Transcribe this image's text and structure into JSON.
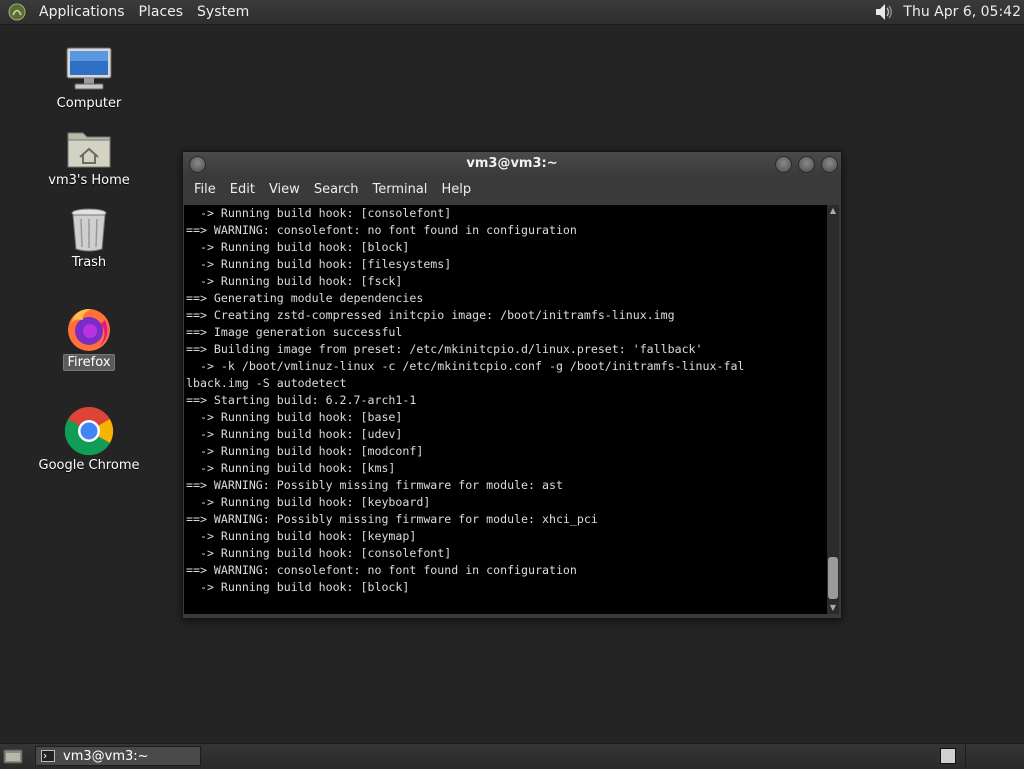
{
  "top_panel": {
    "menus": [
      "Applications",
      "Places",
      "System"
    ],
    "clock": "Thu Apr  6, 05:42",
    "icons": {
      "logo": "distro-logo-icon",
      "volume": "volume-icon"
    }
  },
  "desktop": {
    "icons": [
      {
        "label": "Computer",
        "icon": "computer-icon"
      },
      {
        "label": "vm3's Home",
        "icon": "home-folder-icon"
      },
      {
        "label": "Trash",
        "icon": "trash-icon"
      },
      {
        "label": "Firefox",
        "icon": "firefox-icon",
        "selected": true
      },
      {
        "label": "Google Chrome",
        "icon": "chrome-icon"
      }
    ]
  },
  "terminal": {
    "title": "vm3@vm3:~",
    "menu": [
      "File",
      "Edit",
      "View",
      "Search",
      "Terminal",
      "Help"
    ],
    "lines": [
      "  -> Running build hook: [consolefont]",
      "==> WARNING: consolefont: no font found in configuration",
      "  -> Running build hook: [block]",
      "  -> Running build hook: [filesystems]",
      "  -> Running build hook: [fsck]",
      "==> Generating module dependencies",
      "==> Creating zstd-compressed initcpio image: /boot/initramfs-linux.img",
      "==> Image generation successful",
      "==> Building image from preset: /etc/mkinitcpio.d/linux.preset: 'fallback'",
      "  -> -k /boot/vmlinuz-linux -c /etc/mkinitcpio.conf -g /boot/initramfs-linux-fal",
      "lback.img -S autodetect",
      "==> Starting build: 6.2.7-arch1-1",
      "  -> Running build hook: [base]",
      "  -> Running build hook: [udev]",
      "  -> Running build hook: [modconf]",
      "  -> Running build hook: [kms]",
      "==> WARNING: Possibly missing firmware for module: ast",
      "  -> Running build hook: [keyboard]",
      "==> WARNING: Possibly missing firmware for module: xhci_pci",
      "  -> Running build hook: [keymap]",
      "  -> Running build hook: [consolefont]",
      "==> WARNING: consolefont: no font found in configuration",
      "  -> Running build hook: [block]"
    ]
  },
  "bottom_panel": {
    "task_label": "vm3@vm3:~"
  }
}
